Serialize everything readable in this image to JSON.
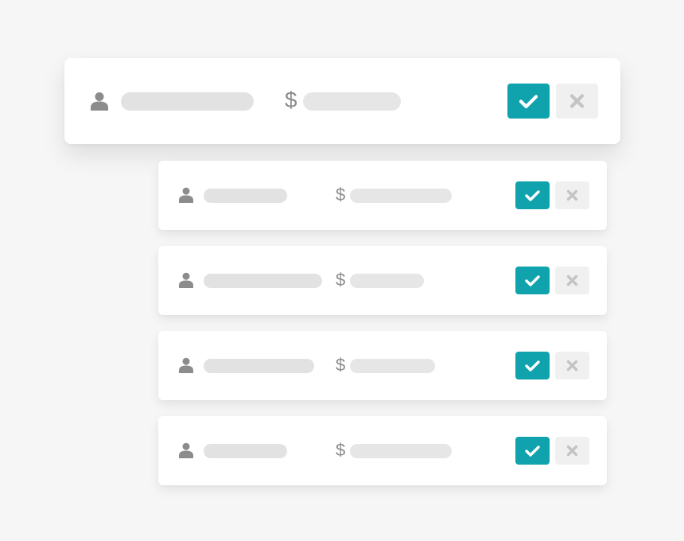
{
  "colors": {
    "background": "#f6f6f6",
    "card": "#ffffff",
    "placeholder_bar": "#e2e2e2",
    "icon_gray": "#8c8c8c",
    "approve_button": "#11a3ad",
    "reject_button": "#f0f0f0",
    "reject_icon": "#c4c4c4"
  },
  "icons": {
    "user": "user-icon",
    "approve": "check-icon",
    "reject": "close-icon"
  },
  "rows": [
    {
      "currency_symbol": "$",
      "featured": true
    },
    {
      "currency_symbol": "$"
    },
    {
      "currency_symbol": "$"
    },
    {
      "currency_symbol": "$"
    },
    {
      "currency_symbol": "$"
    }
  ]
}
